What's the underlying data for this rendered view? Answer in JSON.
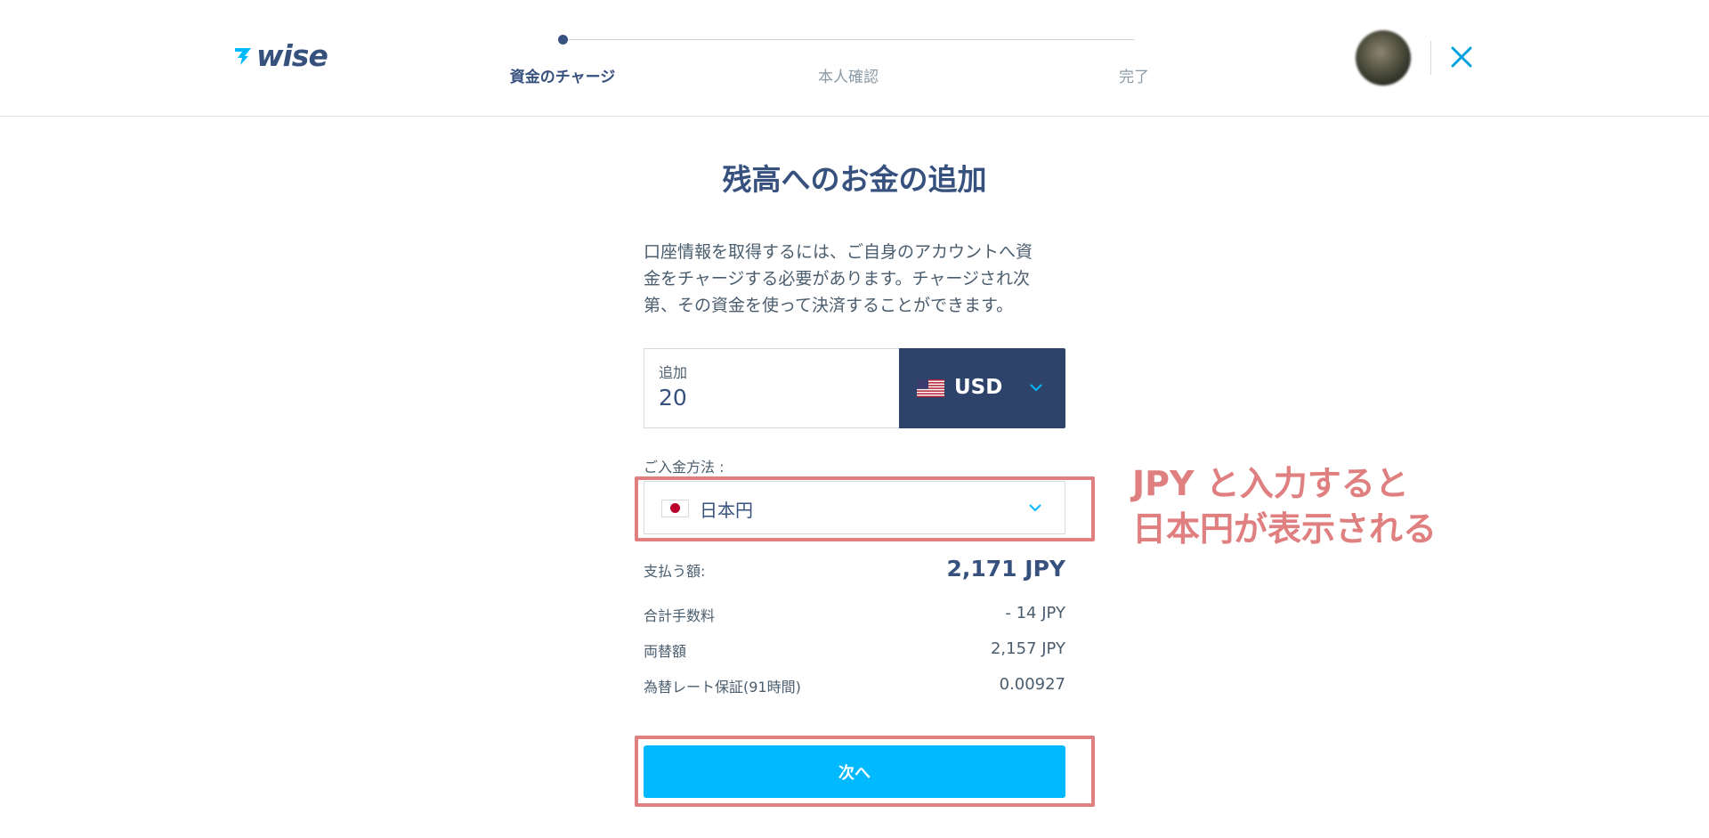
{
  "header": {
    "logo_text": "wise",
    "steps": [
      {
        "label": "資金のチャージ",
        "active": true
      },
      {
        "label": "本人確認",
        "active": false
      },
      {
        "label": "完了",
        "active": false
      }
    ]
  },
  "main": {
    "title": "残高へのお金の追加",
    "intro_lines": [
      "口座情報を取得するには、ご自身のアカウントへ資",
      "金をチャージする必要があります。チャージされ次",
      "第、その資金を使って決済することができます。"
    ],
    "amount": {
      "label": "追加",
      "value": "20"
    },
    "currency": {
      "code": "USD",
      "flag": "us-flag-icon"
    },
    "payment_method": {
      "label": "ご入金方法 :",
      "value": "日本円",
      "flag": "jp-flag-icon"
    },
    "summary": [
      {
        "key": "支払う額:",
        "value": "2,171 JPY"
      },
      {
        "key": "合計手数料",
        "value": "- 14 JPY"
      },
      {
        "key": "両替額",
        "value": "2,157 JPY"
      },
      {
        "key": "為替レート保証(91時間)",
        "value": "0.00927"
      }
    ],
    "next_button": "次へ"
  },
  "annotation": {
    "lines": [
      "JPY と入力すると",
      "日本円が表示される"
    ],
    "color": "#e07f7f"
  },
  "colors": {
    "brand_navy": "#37517e",
    "currency_bg": "#2e4369",
    "accent_blue": "#00b9ff",
    "close_teal": "#00a2dd"
  }
}
